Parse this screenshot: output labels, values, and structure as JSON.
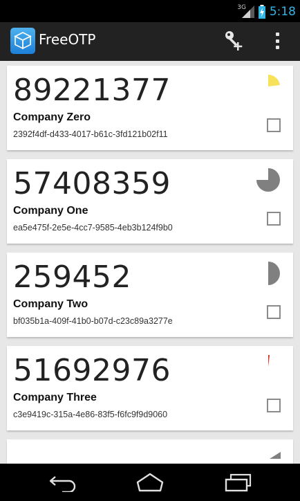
{
  "status_bar": {
    "network_type": "3G",
    "time": "5:18",
    "time_color": "#33b5e5"
  },
  "action_bar": {
    "title": "FreeOTP",
    "icon": "freeotp-cube-icon",
    "actions": [
      "add-token-icon",
      "overflow-menu-icon"
    ]
  },
  "tokens": [
    {
      "code": "89221377",
      "issuer": "Company Zero",
      "label": "2392f4df-d433-4017-b61c-3fd121b02f11",
      "progress": 0.23,
      "progress_color": "#f7e25c"
    },
    {
      "code": "57408359",
      "issuer": "Company One",
      "label": "ea5e475f-2e5e-4cc7-9585-4eb3b124f9b0",
      "progress": 0.75,
      "progress_color": "#808080"
    },
    {
      "code": "259452",
      "issuer": "Company Two",
      "label": "bf035b1a-409f-41b0-b07d-c23c89a3277e",
      "progress": 0.5,
      "progress_color": "#808080"
    },
    {
      "code": "51692976",
      "issuer": "Company Three",
      "label": "c3e9419c-315a-4e86-83f5-f6fc9f9d9060",
      "progress": 0.02,
      "progress_color": "#e0332c"
    }
  ],
  "nav_bar": {
    "buttons": [
      "back-icon",
      "home-icon",
      "recent-apps-icon"
    ]
  }
}
